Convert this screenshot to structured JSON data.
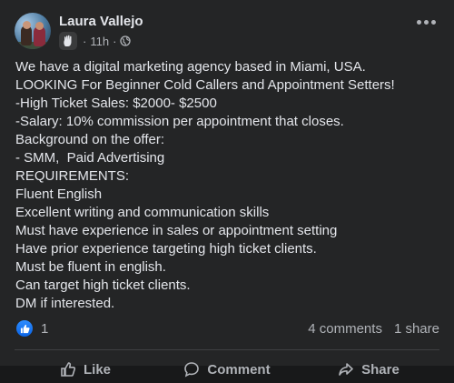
{
  "post": {
    "author": "Laura Vallejo",
    "time": "11h",
    "audience_icon": "globe-icon",
    "badge_icon": "wave-hand-icon",
    "more_icon": "more-dots-icon",
    "lines": [
      "We have a digital marketing agency based in Miami, USA.",
      "LOOKING For Beginner Cold Callers and Appointment Setters!",
      "-High Ticket Sales: $2000- $2500",
      "-Salary: 10% commission per appointment that closes.",
      "Background on the offer:",
      "- SMM,  Paid Advertising",
      "REQUIREMENTS:",
      "Fluent English",
      "Excellent writing and communication skills",
      "Must have experience in sales or appointment setting",
      "Have prior experience targeting high ticket clients.",
      "Must be fluent in english.",
      "Can target high ticket clients.",
      "DM if interested."
    ]
  },
  "reactions": {
    "count": "1",
    "icon": "like-reaction-icon"
  },
  "stats": {
    "comments": "4 comments",
    "shares": "1 share"
  },
  "actions": {
    "like": "Like",
    "comment": "Comment",
    "share": "Share"
  },
  "colors": {
    "background": "#242526",
    "text": "#e4e6eb",
    "muted": "#b0b3b8",
    "like_blue": "#0a64e6"
  }
}
